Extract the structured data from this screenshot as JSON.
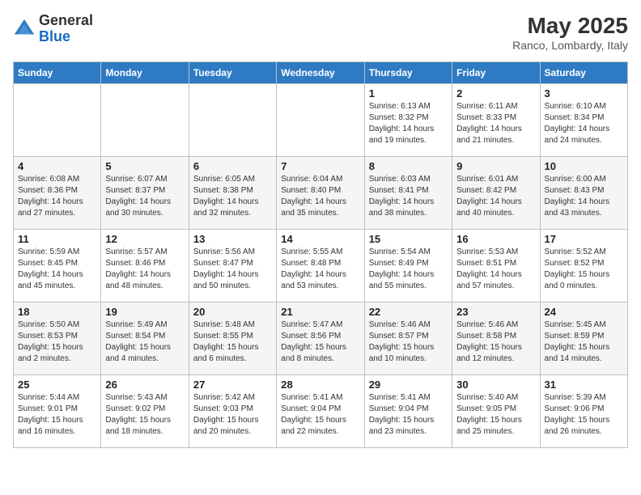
{
  "header": {
    "logo": {
      "general": "General",
      "blue": "Blue"
    },
    "title": "May 2025",
    "location": "Ranco, Lombardy, Italy"
  },
  "days_of_week": [
    "Sunday",
    "Monday",
    "Tuesday",
    "Wednesday",
    "Thursday",
    "Friday",
    "Saturday"
  ],
  "weeks": [
    [
      {
        "day": "",
        "info": ""
      },
      {
        "day": "",
        "info": ""
      },
      {
        "day": "",
        "info": ""
      },
      {
        "day": "",
        "info": ""
      },
      {
        "day": "1",
        "info": "Sunrise: 6:13 AM\nSunset: 8:32 PM\nDaylight: 14 hours and 19 minutes."
      },
      {
        "day": "2",
        "info": "Sunrise: 6:11 AM\nSunset: 8:33 PM\nDaylight: 14 hours and 21 minutes."
      },
      {
        "day": "3",
        "info": "Sunrise: 6:10 AM\nSunset: 8:34 PM\nDaylight: 14 hours and 24 minutes."
      }
    ],
    [
      {
        "day": "4",
        "info": "Sunrise: 6:08 AM\nSunset: 8:36 PM\nDaylight: 14 hours and 27 minutes."
      },
      {
        "day": "5",
        "info": "Sunrise: 6:07 AM\nSunset: 8:37 PM\nDaylight: 14 hours and 30 minutes."
      },
      {
        "day": "6",
        "info": "Sunrise: 6:05 AM\nSunset: 8:38 PM\nDaylight: 14 hours and 32 minutes."
      },
      {
        "day": "7",
        "info": "Sunrise: 6:04 AM\nSunset: 8:40 PM\nDaylight: 14 hours and 35 minutes."
      },
      {
        "day": "8",
        "info": "Sunrise: 6:03 AM\nSunset: 8:41 PM\nDaylight: 14 hours and 38 minutes."
      },
      {
        "day": "9",
        "info": "Sunrise: 6:01 AM\nSunset: 8:42 PM\nDaylight: 14 hours and 40 minutes."
      },
      {
        "day": "10",
        "info": "Sunrise: 6:00 AM\nSunset: 8:43 PM\nDaylight: 14 hours and 43 minutes."
      }
    ],
    [
      {
        "day": "11",
        "info": "Sunrise: 5:59 AM\nSunset: 8:45 PM\nDaylight: 14 hours and 45 minutes."
      },
      {
        "day": "12",
        "info": "Sunrise: 5:57 AM\nSunset: 8:46 PM\nDaylight: 14 hours and 48 minutes."
      },
      {
        "day": "13",
        "info": "Sunrise: 5:56 AM\nSunset: 8:47 PM\nDaylight: 14 hours and 50 minutes."
      },
      {
        "day": "14",
        "info": "Sunrise: 5:55 AM\nSunset: 8:48 PM\nDaylight: 14 hours and 53 minutes."
      },
      {
        "day": "15",
        "info": "Sunrise: 5:54 AM\nSunset: 8:49 PM\nDaylight: 14 hours and 55 minutes."
      },
      {
        "day": "16",
        "info": "Sunrise: 5:53 AM\nSunset: 8:51 PM\nDaylight: 14 hours and 57 minutes."
      },
      {
        "day": "17",
        "info": "Sunrise: 5:52 AM\nSunset: 8:52 PM\nDaylight: 15 hours and 0 minutes."
      }
    ],
    [
      {
        "day": "18",
        "info": "Sunrise: 5:50 AM\nSunset: 8:53 PM\nDaylight: 15 hours and 2 minutes."
      },
      {
        "day": "19",
        "info": "Sunrise: 5:49 AM\nSunset: 8:54 PM\nDaylight: 15 hours and 4 minutes."
      },
      {
        "day": "20",
        "info": "Sunrise: 5:48 AM\nSunset: 8:55 PM\nDaylight: 15 hours and 6 minutes."
      },
      {
        "day": "21",
        "info": "Sunrise: 5:47 AM\nSunset: 8:56 PM\nDaylight: 15 hours and 8 minutes."
      },
      {
        "day": "22",
        "info": "Sunrise: 5:46 AM\nSunset: 8:57 PM\nDaylight: 15 hours and 10 minutes."
      },
      {
        "day": "23",
        "info": "Sunrise: 5:46 AM\nSunset: 8:58 PM\nDaylight: 15 hours and 12 minutes."
      },
      {
        "day": "24",
        "info": "Sunrise: 5:45 AM\nSunset: 8:59 PM\nDaylight: 15 hours and 14 minutes."
      }
    ],
    [
      {
        "day": "25",
        "info": "Sunrise: 5:44 AM\nSunset: 9:01 PM\nDaylight: 15 hours and 16 minutes."
      },
      {
        "day": "26",
        "info": "Sunrise: 5:43 AM\nSunset: 9:02 PM\nDaylight: 15 hours and 18 minutes."
      },
      {
        "day": "27",
        "info": "Sunrise: 5:42 AM\nSunset: 9:03 PM\nDaylight: 15 hours and 20 minutes."
      },
      {
        "day": "28",
        "info": "Sunrise: 5:41 AM\nSunset: 9:04 PM\nDaylight: 15 hours and 22 minutes."
      },
      {
        "day": "29",
        "info": "Sunrise: 5:41 AM\nSunset: 9:04 PM\nDaylight: 15 hours and 23 minutes."
      },
      {
        "day": "30",
        "info": "Sunrise: 5:40 AM\nSunset: 9:05 PM\nDaylight: 15 hours and 25 minutes."
      },
      {
        "day": "31",
        "info": "Sunrise: 5:39 AM\nSunset: 9:06 PM\nDaylight: 15 hours and 26 minutes."
      }
    ]
  ]
}
